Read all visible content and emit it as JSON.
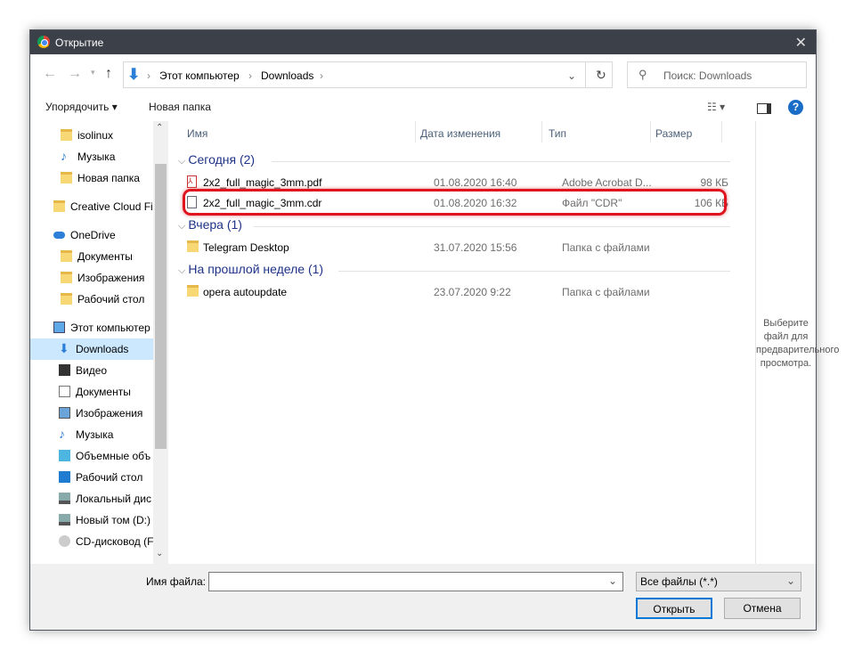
{
  "title": "Открытие",
  "address": {
    "crumbs": [
      "Этот компьютер",
      "Downloads"
    ]
  },
  "search": {
    "placeholder": "Поиск: Downloads"
  },
  "toolbar": {
    "organize": "Упорядочить ▾",
    "new_folder": "Новая папка"
  },
  "sidebar": [
    {
      "label": "isolinux",
      "icon": "folder"
    },
    {
      "label": "Музыка",
      "icon": "music"
    },
    {
      "label": "Новая папка",
      "icon": "folder"
    },
    {
      "label": "Creative Cloud Fil",
      "icon": "cc-folder"
    },
    {
      "label": "OneDrive",
      "icon": "cloud"
    },
    {
      "label": "Документы",
      "icon": "folder"
    },
    {
      "label": "Изображения",
      "icon": "folder"
    },
    {
      "label": "Рабочий стол",
      "icon": "folder"
    },
    {
      "label": "Этот компьютер",
      "icon": "computer"
    },
    {
      "label": "Downloads",
      "icon": "download"
    },
    {
      "label": "Видео",
      "icon": "video"
    },
    {
      "label": "Документы",
      "icon": "document"
    },
    {
      "label": "Изображения",
      "icon": "image"
    },
    {
      "label": "Музыка",
      "icon": "music"
    },
    {
      "label": "Объемные объ",
      "icon": "3d"
    },
    {
      "label": "Рабочий стол",
      "icon": "desktop"
    },
    {
      "label": "Локальный дис",
      "icon": "drive"
    },
    {
      "label": "Новый том (D:)",
      "icon": "drive"
    },
    {
      "label": "CD-дисковод (F",
      "icon": "cd"
    }
  ],
  "columns": {
    "name": "Имя",
    "date": "Дата изменения",
    "type": "Тип",
    "size": "Размер"
  },
  "groups": [
    {
      "label": "Сегодня (2)",
      "items": [
        {
          "name": "2x2_full_magic_3mm.pdf",
          "date": "01.08.2020 16:40",
          "type": "Adobe Acrobat D...",
          "size": "98 КБ",
          "icon": "pdf"
        },
        {
          "name": "2x2_full_magic_3mm.cdr",
          "date": "01.08.2020 16:32",
          "type": "Файл \"CDR\"",
          "size": "106 КБ",
          "icon": "file"
        }
      ]
    },
    {
      "label": "Вчера (1)",
      "items": [
        {
          "name": "Telegram Desktop",
          "date": "31.07.2020 15:56",
          "type": "Папка с файлами",
          "icon": "folder"
        }
      ]
    },
    {
      "label": "На прошлой неделе (1)",
      "items": [
        {
          "name": "opera autoupdate",
          "date": "23.07.2020 9:22",
          "type": "Папка с файлами",
          "icon": "folder"
        }
      ]
    }
  ],
  "preview": "Выберите файл для предварительного просмотра.",
  "bottom": {
    "filename_label": "Имя файла:",
    "filename_value": "",
    "filetype": "Все файлы (*.*)",
    "open": "Открыть",
    "cancel": "Отмена"
  }
}
